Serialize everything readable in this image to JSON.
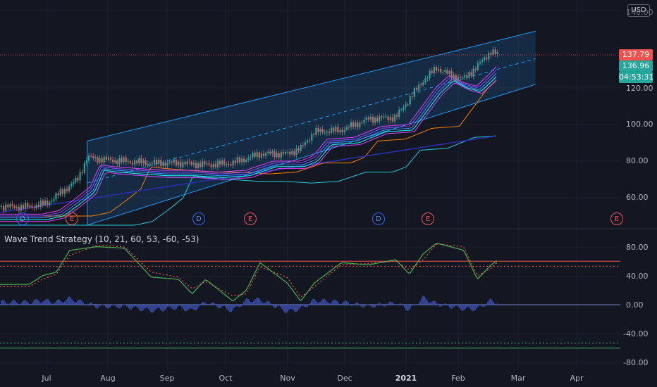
{
  "currency_label": "USD",
  "price_axis": {
    "ticks": [
      "140.00",
      "120.00",
      "100.00",
      "80.00",
      "60.00"
    ],
    "last_price": "137.79",
    "ma_price": "136.96",
    "countdown": "04:53:31"
  },
  "indicator": {
    "title": "Wave Trend Strategy (10, 21, 60, 53, -60, -53)",
    "ticks": [
      "80.00",
      "40.00",
      "0.00",
      "-40.00",
      "-80.00"
    ]
  },
  "time_axis": {
    "ticks": [
      {
        "label": "Jul",
        "bold": false
      },
      {
        "label": "Aug",
        "bold": false
      },
      {
        "label": "Sep",
        "bold": false
      },
      {
        "label": "Oct",
        "bold": false
      },
      {
        "label": "Nov",
        "bold": false
      },
      {
        "label": "Dec",
        "bold": false
      },
      {
        "label": "2021",
        "bold": true
      },
      {
        "label": "Feb",
        "bold": false
      },
      {
        "label": "Mar",
        "bold": false
      },
      {
        "label": "Apr",
        "bold": false
      }
    ]
  },
  "events": [
    "D",
    "E",
    "D",
    "E",
    "D",
    "E",
    "E"
  ],
  "colors": {
    "background": "#131722",
    "up": "#26a69a",
    "down": "#ef5350",
    "channel": "#2196f3",
    "ma_orange": "#f57c00",
    "ma_teal": "#26c6da",
    "ma_navy": "#2a2fb0",
    "wt1": "#4caf50",
    "wt2": "#ef5350",
    "hist": "#3f51b5"
  },
  "chart_data": {
    "type": "candlestick",
    "price_ylim": [
      50,
      150
    ],
    "price_path": [
      [
        "2020-06-22",
        55
      ],
      [
        "2020-07-01",
        57
      ],
      [
        "2020-07-10",
        64
      ],
      [
        "2020-07-17",
        70
      ],
      [
        "2020-07-22",
        82
      ],
      [
        "2020-07-29",
        81
      ],
      [
        "2020-08-10",
        80
      ],
      [
        "2020-08-24",
        79
      ],
      [
        "2020-09-07",
        79
      ],
      [
        "2020-09-21",
        78
      ],
      [
        "2020-10-05",
        79
      ],
      [
        "2020-10-19",
        84
      ],
      [
        "2020-11-02",
        84
      ],
      [
        "2020-11-09",
        87
      ],
      [
        "2020-11-16",
        96
      ],
      [
        "2020-11-30",
        97
      ],
      [
        "2020-12-14",
        103
      ],
      [
        "2020-12-28",
        104
      ],
      [
        "2021-01-11",
        124
      ],
      [
        "2021-01-18",
        131
      ],
      [
        "2021-01-25",
        127
      ],
      [
        "2021-02-01",
        125
      ],
      [
        "2021-02-08",
        132
      ],
      [
        "2021-02-15",
        140
      ],
      [
        "2021-02-19",
        137.79
      ]
    ],
    "indicator_ylim": [
      -90,
      90
    ],
    "wt1_path": [
      [
        "2020-06-22",
        28
      ],
      [
        "2020-06-29",
        40
      ],
      [
        "2020-07-06",
        45
      ],
      [
        "2020-07-13",
        75
      ],
      [
        "2020-07-27",
        80
      ],
      [
        "2020-08-10",
        78
      ],
      [
        "2020-08-24",
        38
      ],
      [
        "2020-09-07",
        35
      ],
      [
        "2020-09-14",
        15
      ],
      [
        "2020-09-21",
        35
      ],
      [
        "2020-10-05",
        5
      ],
      [
        "2020-10-12",
        20
      ],
      [
        "2020-10-19",
        58
      ],
      [
        "2020-11-02",
        30
      ],
      [
        "2020-11-09",
        5
      ],
      [
        "2020-11-16",
        30
      ],
      [
        "2020-11-30",
        58
      ],
      [
        "2020-12-14",
        55
      ],
      [
        "2020-12-28",
        62
      ],
      [
        "2021-01-04",
        42
      ],
      [
        "2021-01-11",
        70
      ],
      [
        "2021-01-18",
        85
      ],
      [
        "2021-02-01",
        75
      ],
      [
        "2021-02-08",
        35
      ],
      [
        "2021-02-15",
        55
      ],
      [
        "2021-02-19",
        62
      ]
    ],
    "wt2_path": [
      [
        "2020-06-22",
        25
      ],
      [
        "2020-06-29",
        35
      ],
      [
        "2020-07-06",
        42
      ],
      [
        "2020-07-13",
        68
      ],
      [
        "2020-07-27",
        82
      ],
      [
        "2020-08-10",
        80
      ],
      [
        "2020-08-24",
        45
      ],
      [
        "2020-09-07",
        38
      ],
      [
        "2020-09-14",
        22
      ],
      [
        "2020-09-21",
        32
      ],
      [
        "2020-10-05",
        12
      ],
      [
        "2020-10-12",
        15
      ],
      [
        "2020-10-19",
        52
      ],
      [
        "2020-11-02",
        38
      ],
      [
        "2020-11-09",
        10
      ],
      [
        "2020-11-16",
        25
      ],
      [
        "2020-11-30",
        55
      ],
      [
        "2020-12-14",
        57
      ],
      [
        "2020-12-28",
        60
      ],
      [
        "2021-01-04",
        48
      ],
      [
        "2021-01-11",
        62
      ],
      [
        "2021-01-18",
        84
      ],
      [
        "2021-02-01",
        80
      ],
      [
        "2021-02-08",
        40
      ],
      [
        "2021-02-15",
        50
      ],
      [
        "2021-02-19",
        60
      ]
    ],
    "levels": {
      "overbought": [
        60,
        53
      ],
      "oversold": [
        -60,
        -53
      ],
      "zero": 0
    }
  }
}
